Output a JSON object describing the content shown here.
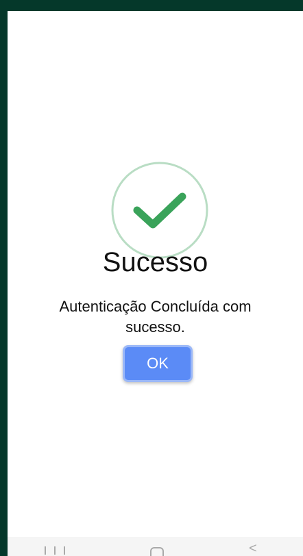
{
  "dialog": {
    "title": "Sucesso",
    "message": "Autenticação Concluída com sucesso.",
    "ok_label": "OK",
    "icon": "check-circle-icon"
  },
  "colors": {
    "background_frame": "#05382a",
    "success_green": "#3aa35a",
    "ok_button": "#5b8bf6"
  },
  "navbar": {
    "recent_icon": "recent-apps-icon",
    "home_icon": "home-icon",
    "back_label": "<"
  }
}
